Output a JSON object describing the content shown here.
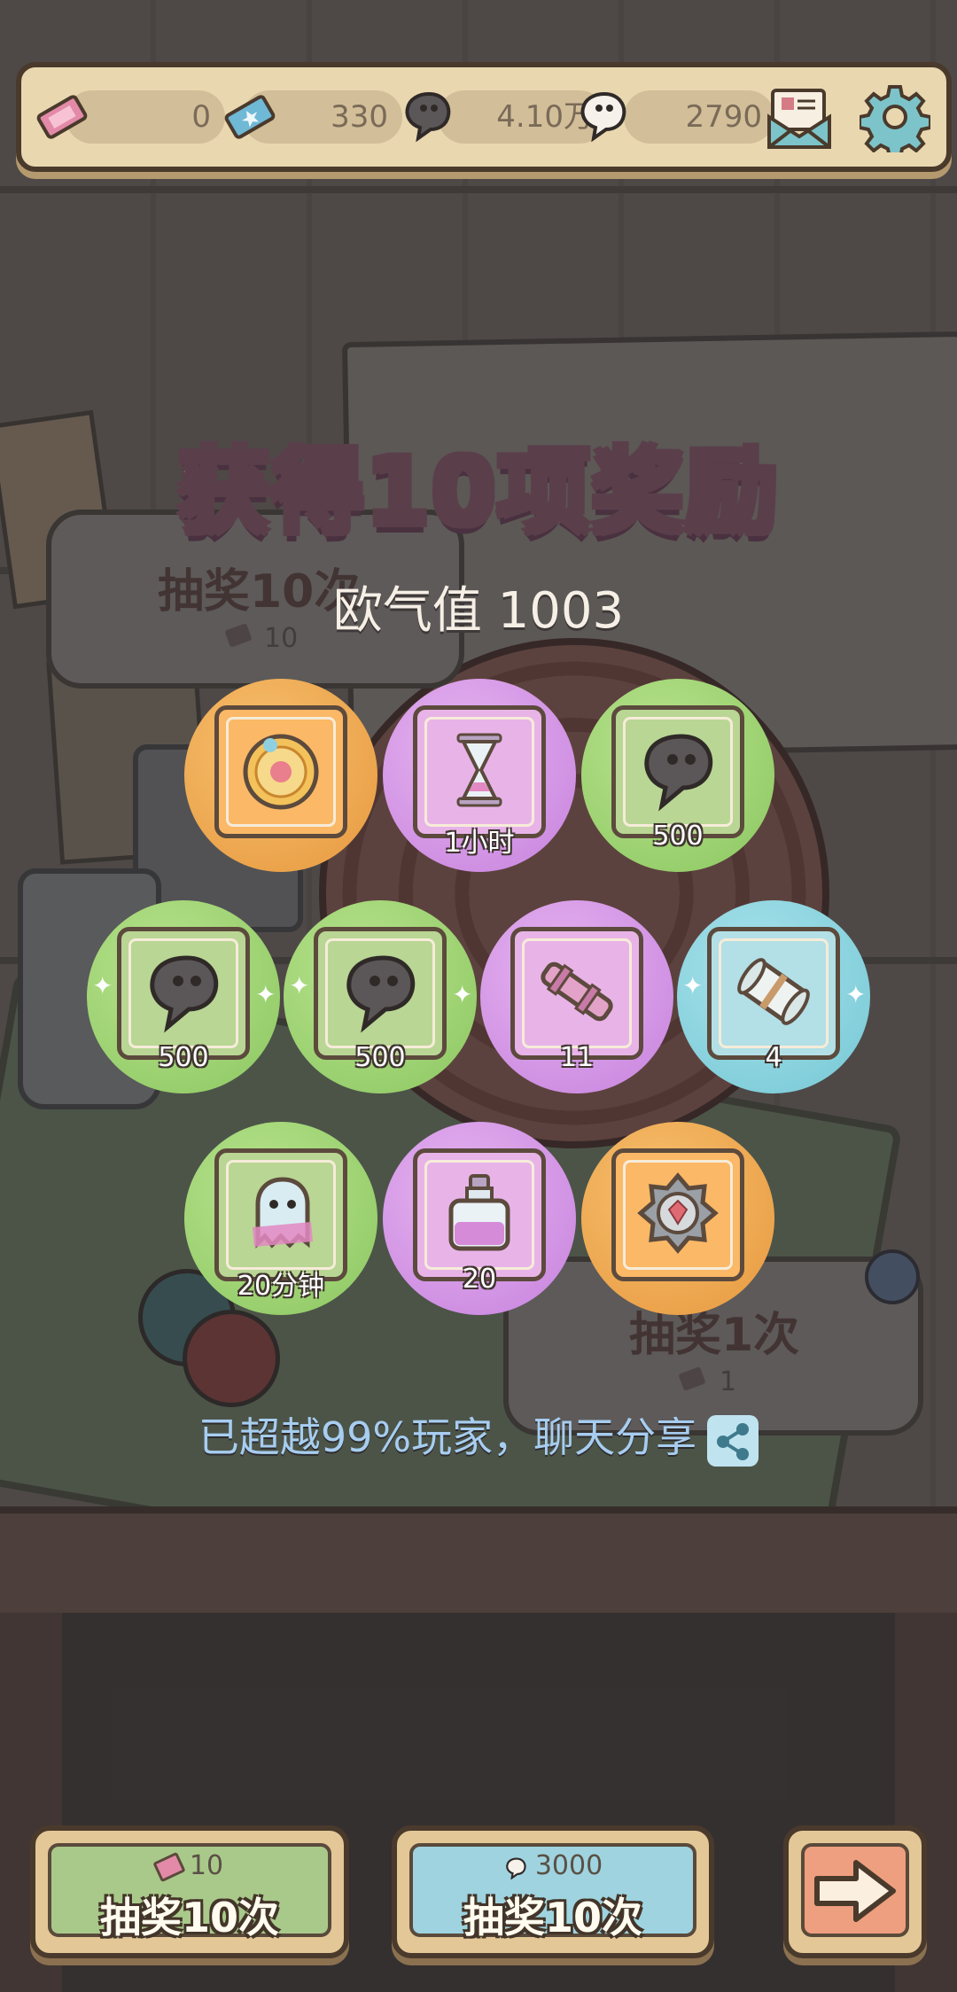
{
  "topbar": {
    "ticket_pink": "0",
    "ticket_blue": "330",
    "dark_soul": "4.10万",
    "white_soul": "2790",
    "mail_icon": "mail-icon",
    "settings_icon": "gear-icon"
  },
  "background": {
    "draw10": {
      "title": "抽奖10次",
      "cost": "10"
    },
    "draw1": {
      "title": "抽奖1次",
      "cost": "1"
    }
  },
  "title": "获得10项奖励",
  "luck_label": "欧气值 1003",
  "rewards": [
    {
      "rarity": "orange",
      "icon": "golden-medallion-icon",
      "qty": ""
    },
    {
      "rarity": "purple",
      "icon": "hourglass-icon",
      "qty": "1小时"
    },
    {
      "rarity": "green",
      "icon": "dark-soul-icon",
      "qty": "500"
    },
    {
      "rarity": "green",
      "icon": "dark-soul-icon",
      "qty": "500"
    },
    {
      "rarity": "green",
      "icon": "dark-soul-icon",
      "qty": "500"
    },
    {
      "rarity": "purple",
      "icon": "telescope-icon",
      "qty": "11"
    },
    {
      "rarity": "teal",
      "icon": "scroll-icon",
      "qty": "4"
    },
    {
      "rarity": "green",
      "icon": "ghost-icon",
      "qty": "20分钟"
    },
    {
      "rarity": "purple",
      "icon": "potion-bottle-icon",
      "qty": "20"
    },
    {
      "rarity": "orange",
      "icon": "gem-badge-icon",
      "qty": ""
    }
  ],
  "share_text": "已超越99%玩家，聊天分享",
  "buttons": {
    "draw10_ticket": {
      "cost": "10",
      "label": "抽奖10次"
    },
    "draw10_soul": {
      "cost": "3000",
      "label": "抽奖10次"
    },
    "next": {
      "icon": "arrow-right-icon"
    }
  },
  "colors": {
    "orange": "#e7993f",
    "purple": "#c782dd",
    "green": "#8cc761",
    "teal": "#74c7d4",
    "share_text": "#a7cdf0"
  }
}
